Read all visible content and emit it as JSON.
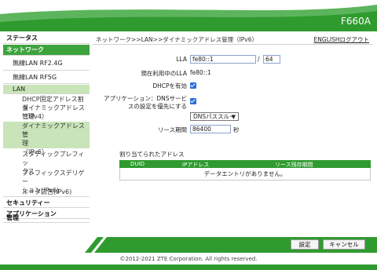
{
  "header": {
    "model": "F660A"
  },
  "sidebar": {
    "categories": {
      "status": "ステータス",
      "network": "ネットワーク",
      "security": "セキュリティー",
      "application": "アプリケーション",
      "management": "管理"
    },
    "subs": {
      "wlan_24": "無線LAN RF2.4G",
      "wlan_5": "無線LAN RF5G",
      "lan": "LAN"
    },
    "leaves": {
      "dhcp_fixed": "DHCP固定アドレス割当",
      "dynamic_v4_a": "ダイナミックアドレス管理",
      "dynamic_v4_b": "（IPv4）",
      "dynamic_v6_a": "ダイナミックアドレス管",
      "dynamic_v6_b": "理",
      "dynamic_v6_c": "（IPv6）",
      "static_prefix_a": "スタティックプレフィッ",
      "static_prefix_b": "クス",
      "prefix_deleg_a": "プレフィックスデリゲー",
      "prefix_deleg_b": "ション(IPv6)",
      "router_adv": "ルータ広告(IPv6)"
    }
  },
  "content": {
    "breadcrumb": "ネットワーク>>LAN>>ダイナミックアドレス管理（IPv6）",
    "lang_link": "ENGLISHログアウト",
    "lla_label": "LLA",
    "lla_value": "fe80::1",
    "lla_sep": "/",
    "lla_prefix": "64",
    "current_lla_label": "現在利用中のLLA",
    "current_lla_value": "fe80::1",
    "dhcp_enable_label": "DHCPを有効",
    "dns_priority_label_1": "アプリケーション：DNSサービ",
    "dns_priority_label_2": "スの設定を優先にする",
    "dns_select_value": "DNSパススルー",
    "lease_label": "リース期間",
    "lease_value": "86400",
    "lease_unit": "秒",
    "table_title": "割り当てられたアドレス",
    "table_headers": [
      "DUID",
      "IPアドレス",
      "リース残存期間"
    ],
    "table_empty": "データエントリがありません。"
  },
  "footer": {
    "apply_label": "設定",
    "cancel_label": "キャンセル",
    "copyright": "©2012-2021 ZTE Corporation. All rights reserved."
  },
  "colors": {
    "brand_green": "#2f9b2f",
    "sidebar_highlight": "#c9e4b9",
    "checkbox_blue": "#2a6fdc"
  }
}
